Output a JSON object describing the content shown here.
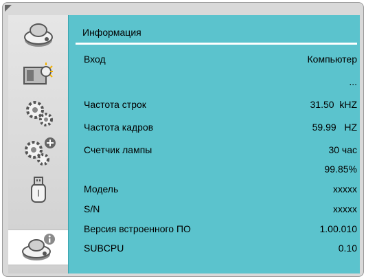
{
  "panel": {
    "title": "Информация"
  },
  "rows": [
    {
      "label": "Вход",
      "value": "Компьютер"
    },
    {
      "label": "",
      "value": "..."
    },
    {
      "label": "Частота строк",
      "value": "31.50  kHZ"
    },
    {
      "label": "Частота кадров",
      "value": "59.99   HZ"
    },
    {
      "label": "Счетчик лампы",
      "value": "30 час"
    },
    {
      "label": "",
      "value": "99.85%"
    },
    {
      "label": "Модель",
      "value": "xxxxx"
    },
    {
      "label": "S/N",
      "value": "xxxxx"
    },
    {
      "label": "Версия встроенного ПО",
      "value": "1.00.010"
    },
    {
      "label": "SUBCPU",
      "value": "0.10"
    }
  ],
  "sidebar": {
    "items": [
      {
        "icon": "projector-icon",
        "active": false
      },
      {
        "icon": "picture-settings-icon",
        "active": false
      },
      {
        "icon": "settings-gears-icon",
        "active": false
      },
      {
        "icon": "advanced-settings-gears-icon",
        "active": false
      },
      {
        "icon": "usb-icon",
        "active": false
      },
      {
        "icon": "projector-info-icon",
        "active": true
      }
    ]
  },
  "colors": {
    "panel": "#5bc3cd",
    "sidebar": "#d9d9d9",
    "highlight": "#ffffff"
  }
}
